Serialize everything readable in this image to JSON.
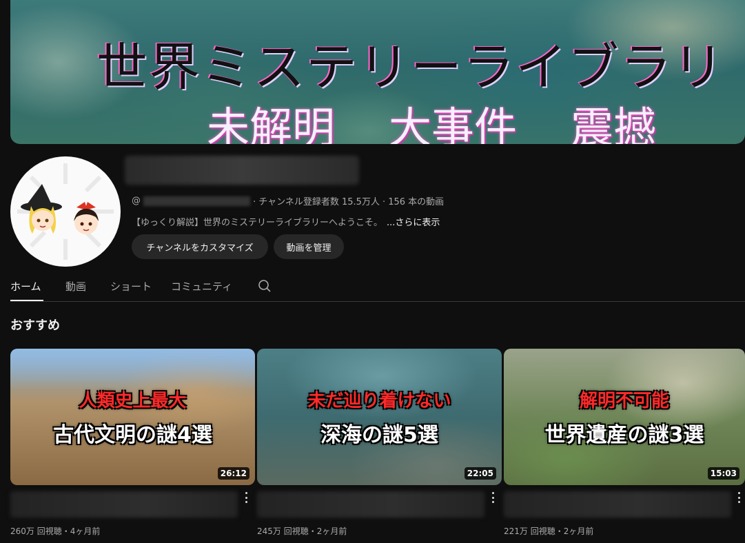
{
  "banner": {
    "title": "世界ミステリーライブラリ",
    "subtitles": [
      "未解明",
      "大事件",
      "震撼"
    ]
  },
  "channel": {
    "handle_prefix": "@",
    "subscribers": "· チャンネル登録者数 15.5万人",
    "video_count": "· 156 本の動画",
    "description": "【ゆっくり解説】世界のミステリーライブラリーへようこそ。",
    "more_label": "...さらに表示",
    "customize_label": "チャンネルをカスタマイズ",
    "manage_label": "動画を管理"
  },
  "tabs": [
    {
      "label": "ホーム",
      "active": true
    },
    {
      "label": "動画"
    },
    {
      "label": "ショート"
    },
    {
      "label": "コミュニティ"
    }
  ],
  "section_title": "おすすめ",
  "videos": [
    {
      "thumb_red": "人類史上最大",
      "thumb_white": "古代文明の謎4選",
      "duration": "26:12",
      "views": "260万 回視聴・4ヶ月前"
    },
    {
      "thumb_red": "未だ辿り着けない",
      "thumb_white": "深海の謎5選",
      "duration": "22:05",
      "views": "245万 回視聴・2ヶ月前"
    },
    {
      "thumb_red": "解明不可能",
      "thumb_white": "世界遺産の謎3選",
      "duration": "15:03",
      "views": "221万 回視聴・2ヶ月前"
    }
  ],
  "colors": {
    "background": "#0f0f0f",
    "button_bg": "#272727",
    "thumb_red_text": "#ff2a2a"
  }
}
